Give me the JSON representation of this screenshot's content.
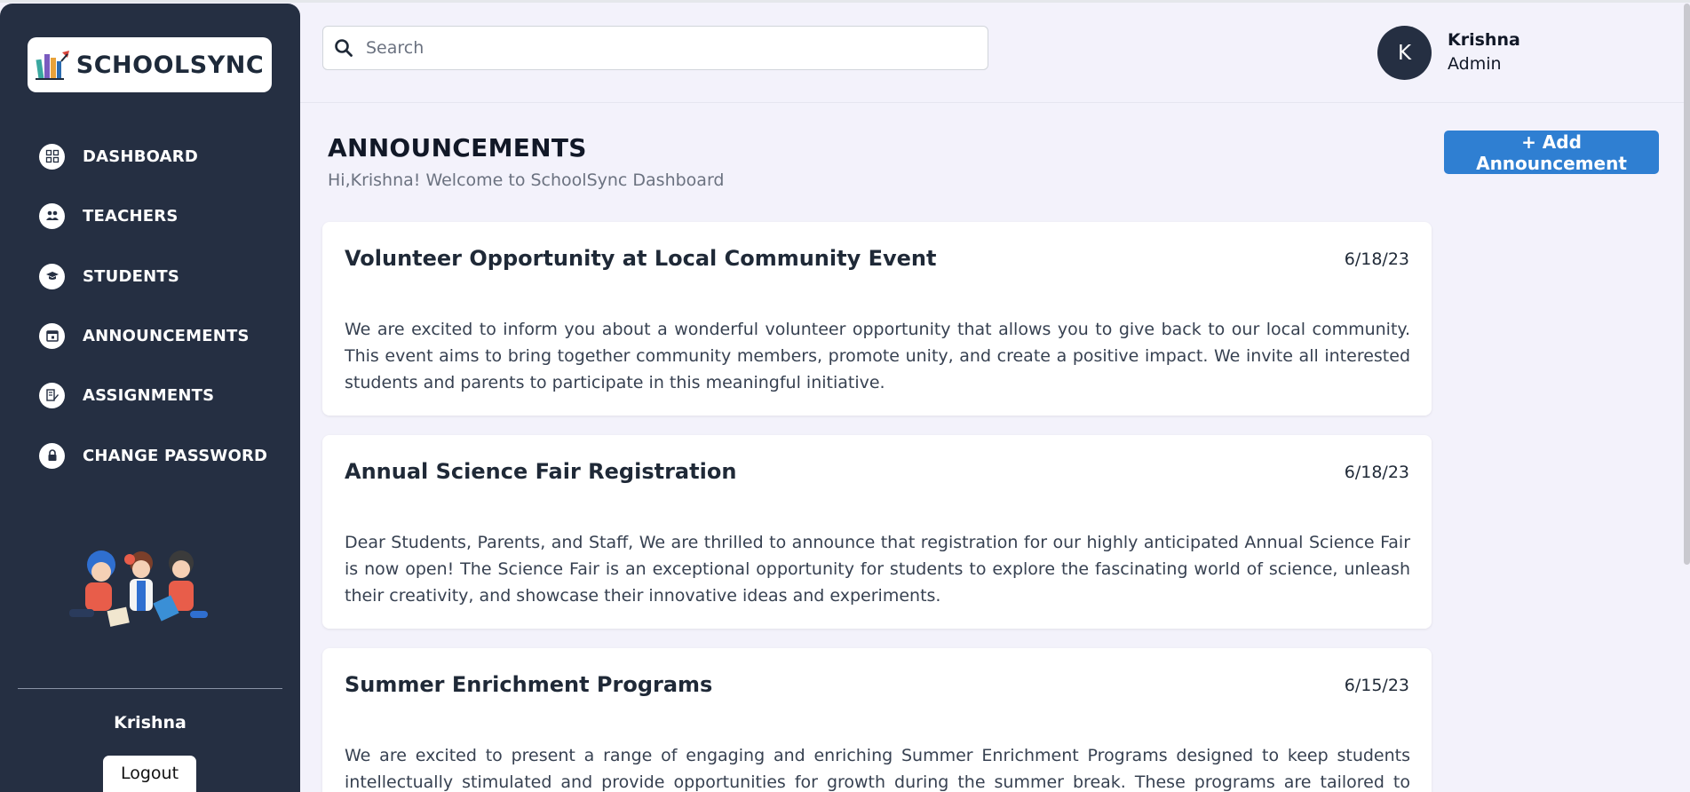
{
  "brand": {
    "name": "SCHOOLSYNC"
  },
  "sidebar": {
    "items": [
      {
        "label": "DASHBOARD",
        "icon": "grid-icon"
      },
      {
        "label": "TEACHERS",
        "icon": "people-icon"
      },
      {
        "label": "STUDENTS",
        "icon": "graduation-cap-icon"
      },
      {
        "label": "ANNOUNCEMENTS",
        "icon": "calendar-icon"
      },
      {
        "label": "ASSIGNMENTS",
        "icon": "edit-document-icon"
      },
      {
        "label": "CHANGE PASSWORD",
        "icon": "lock-icon"
      }
    ],
    "user_name": "Krishna",
    "logout_label": "Logout"
  },
  "header": {
    "search_placeholder": "Search",
    "avatar_initial": "K",
    "user_name": "Krishna",
    "user_role": "Admin"
  },
  "main": {
    "title": "ANNOUNCEMENTS",
    "subtitle": "Hi,Krishna! Welcome to SchoolSync Dashboard",
    "add_button_label": "+ Add Announcement",
    "announcements": [
      {
        "title": "Volunteer Opportunity at Local Community Event",
        "date": "6/18/23",
        "body": "We are excited to inform you about a wonderful volunteer opportunity that allows you to give back to our local community. This event aims to bring together community members, promote unity, and create a positive impact. We invite all interested students and parents to participate in this meaningful initiative."
      },
      {
        "title": "Annual Science Fair Registration",
        "date": "6/18/23",
        "body": "Dear Students, Parents, and Staff, We are thrilled to announce that registration for our highly anticipated Annual Science Fair is now open! The Science Fair is an exceptional opportunity for students to explore the fascinating world of science, unleash their creativity, and showcase their innovative ideas and experiments."
      },
      {
        "title": "Summer Enrichment Programs",
        "date": "6/15/23",
        "body": "We are excited to present a range of engaging and enriching Summer Enrichment Programs designed to keep students intellectually stimulated and provide opportunities for growth during the summer break. These programs are tailored to different grade levels and"
      }
    ]
  },
  "colors": {
    "sidebar_bg": "#252f42",
    "page_bg": "#f3f2fb",
    "accent": "#2f7fd2"
  }
}
